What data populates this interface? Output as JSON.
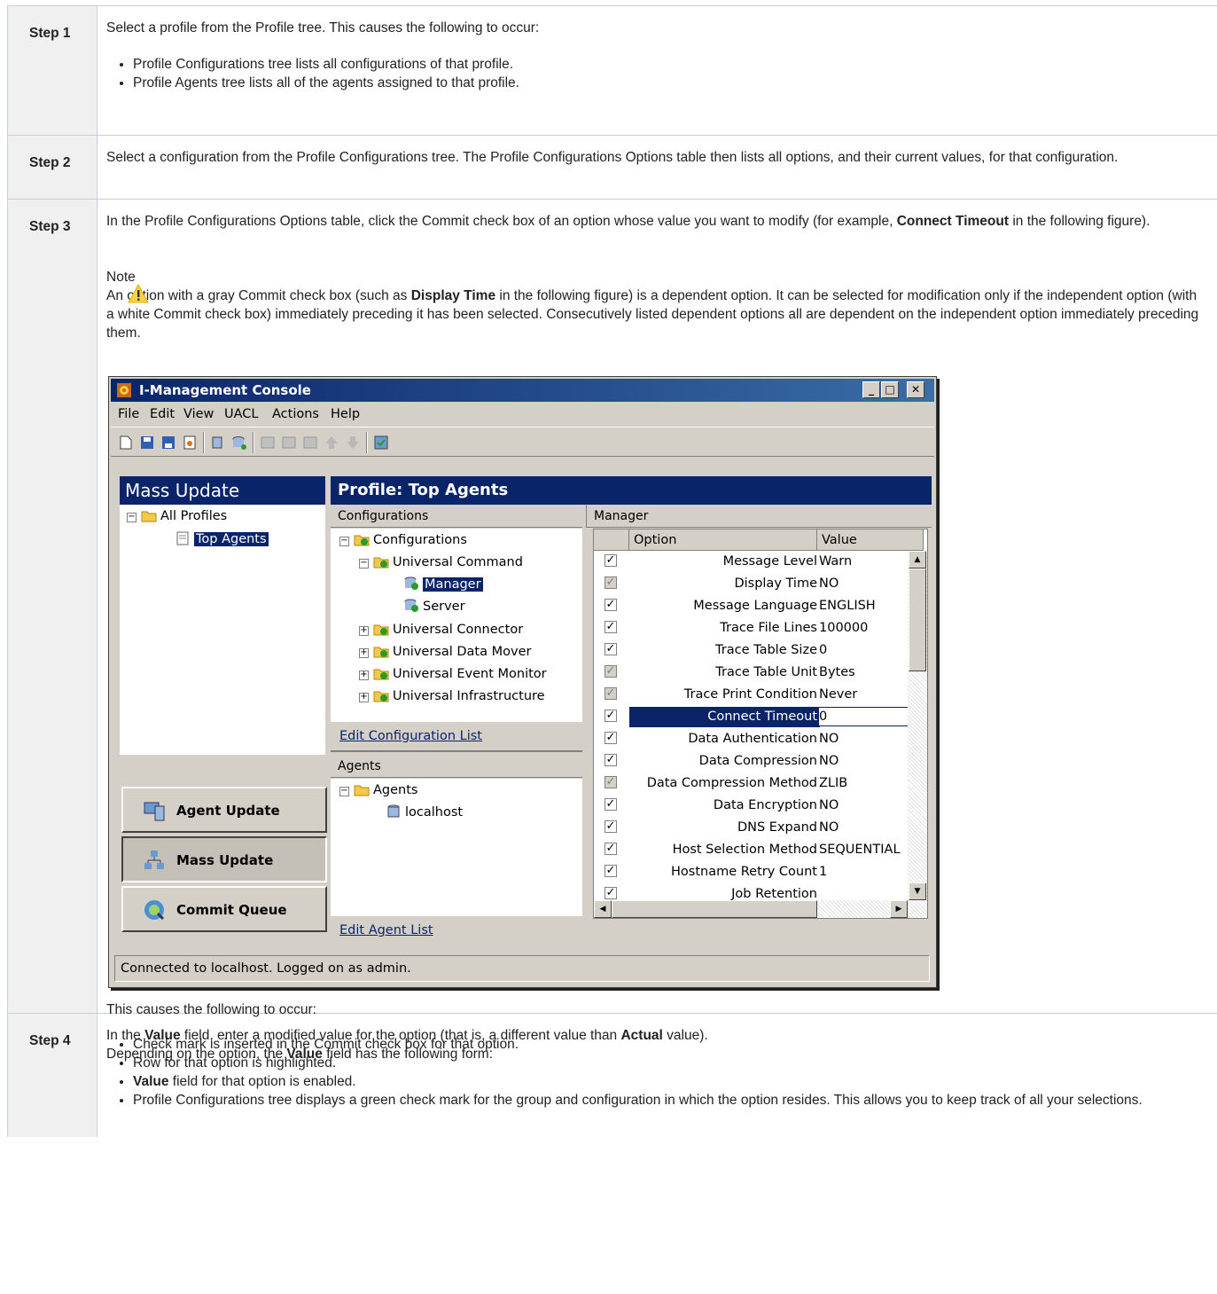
{
  "steps": [
    {
      "label": "Step 1",
      "text": "Select a profile from the Profile tree. This causes the following to occur:",
      "bullets": [
        "Profile Configurations tree lists all configurations of that profile.",
        "Profile Agents tree lists all of the agents assigned to that profile."
      ]
    },
    {
      "label": "Step 2",
      "text": "Select a configuration from the Profile Configurations tree. The Profile Configurations Options table then lists all options, and their current values, for that configuration."
    },
    {
      "label": "Step 3",
      "text_before": "In the Profile Configurations Options table, click the Commit check box of an option whose value you want to modify (for example, ",
      "text_bold": "Connect Timeout",
      "text_after": " in the following figure).",
      "note_title": "Note",
      "note_before": "An option with a gray Commit check box (such as ",
      "note_bold": "Display Time",
      "note_after": " in the following figure) is a dependent option. It can be selected for modification only if the independent option (with a white Commit check box) immediately preceding it has been selected. Consecutively listed dependent options all are dependent on the independent option immediately preceding them.",
      "result_intro": "This causes the following to occur:",
      "bullets": [
        "Check mark is inserted in the Commit check box for that option.",
        "Row for that option is highlighted."
      ],
      "bullet3_bold": "Value",
      "bullet3_rest": " field for that option is enabled.",
      "bullet4": "Profile Configurations tree displays a green check mark for the group and configuration in which the option resides. This allows you to keep track of all your selections."
    },
    {
      "label": "Step 4",
      "line1_a": "In the ",
      "line1_b": "Value",
      "line1_c": " field, enter a modified value for the option (that is, a different value than ",
      "line1_d": "Actual",
      "line1_e": " value).",
      "line2_a": "Depending on the option, the ",
      "line2_b": "Value",
      "line2_c": " field has the following form:"
    }
  ],
  "screenshot": {
    "window_title": "I-Management Console",
    "menu": [
      "File",
      "Edit",
      "View",
      "UACL",
      "Actions",
      "Help"
    ],
    "left_header": "Mass Update",
    "profile_tree": {
      "root": "All Profiles",
      "child": "Top Agents"
    },
    "nav_buttons": [
      "Agent Update",
      "Mass Update",
      "Commit Queue"
    ],
    "profile_header": "Profile:  Top Agents",
    "configurations_header": "Configurations",
    "config_tree": {
      "root": "Configurations",
      "uc": "Universal Command",
      "manager": "Manager",
      "server": "Server",
      "others": [
        "Universal Connector",
        "Universal Data Mover",
        "Universal Event Monitor",
        "Universal Infrastructure"
      ]
    },
    "edit_config_link": "Edit Configuration List",
    "agents_header": "Agents",
    "agents_tree": {
      "root": "Agents",
      "child": "localhost"
    },
    "edit_agent_link": "Edit Agent List",
    "grid_header": "Manager",
    "columns": {
      "option": "Option",
      "value": "Value"
    },
    "rows": [
      {
        "option": "Message Level",
        "value": "Warn",
        "dependent": false
      },
      {
        "option": "Display Time",
        "value": "NO",
        "dependent": true
      },
      {
        "option": "Message Language",
        "value": "ENGLISH",
        "dependent": false
      },
      {
        "option": "Trace File Lines",
        "value": "100000",
        "dependent": false
      },
      {
        "option": "Trace Table Size",
        "value": "0",
        "dependent": false
      },
      {
        "option": "Trace Table Unit",
        "value": "Bytes",
        "dependent": true
      },
      {
        "option": "Trace Print Condition",
        "value": "Never",
        "dependent": true
      },
      {
        "option": "Connect Timeout",
        "value": "0",
        "dependent": false,
        "selected": true
      },
      {
        "option": "Data Authentication",
        "value": "NO",
        "dependent": false
      },
      {
        "option": "Data Compression",
        "value": "NO",
        "dependent": false
      },
      {
        "option": "Data Compression Method",
        "value": "ZLIB",
        "dependent": true
      },
      {
        "option": "Data Encryption",
        "value": "NO",
        "dependent": false
      },
      {
        "option": "DNS Expand",
        "value": "NO",
        "dependent": false
      },
      {
        "option": "Host Selection Method",
        "value": "SEQUENTIAL",
        "dependent": false
      },
      {
        "option": "Hostname Retry Count",
        "value": "1",
        "dependent": false
      },
      {
        "option": "Job Retention",
        "value": "",
        "dependent": false
      }
    ],
    "status": "Connected to localhost.  Logged on as admin."
  }
}
